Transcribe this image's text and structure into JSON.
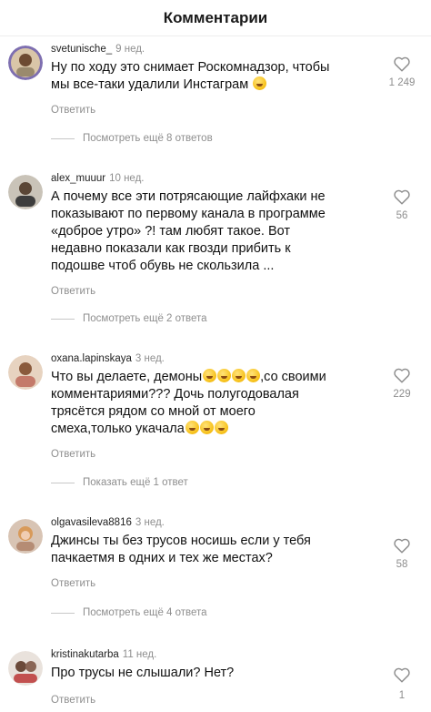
{
  "header": {
    "title": "Комментарии"
  },
  "comments": [
    {
      "username": "svetunische_",
      "time": "9 нед.",
      "text_lines": [
        "Ну по ходу это снимает Роскомнадзор, чтобы",
        "мы все-таки удалили Инстаграм"
      ],
      "reply_label": "Ответить",
      "likes": "1 249",
      "view_replies": "Посмотреть ещё 8 ответов"
    },
    {
      "username": "alex_muuur",
      "time": "10 нед.",
      "text_lines": [
        "А почему все эти потрясающие лайфхаки не",
        "показывают по первому канала в программе",
        "«доброе утро» ?! там любят такое. Вот",
        "недавно показали как гвозди прибить к",
        "подошве чтоб обувь не скользила ..."
      ],
      "reply_label": "Ответить",
      "likes": "56",
      "view_replies": "Посмотреть ещё 2 ответа"
    },
    {
      "username": "oxana.lapinskaya",
      "time": "3 нед.",
      "text_lines": [
        "Что вы делаете, демоны",
        ",со своими",
        "комментариями??? Дочь полугодовалая",
        "трясётся рядом со мной от моего",
        "смеха,только укачала"
      ],
      "reply_label": "Ответить",
      "likes": "229",
      "view_replies": "Показать ещё 1 ответ"
    },
    {
      "username": "olgavasileva8816",
      "time": "3 нед.",
      "text_lines": [
        "Джинсы ты без трусов носишь если у тебя",
        "пачкаетмя в одних и тех же местах?"
      ],
      "reply_label": "Ответить",
      "likes": "58",
      "view_replies": "Посмотреть ещё 4 ответа"
    },
    {
      "username": "kristinakutarba",
      "time": "11 нед.",
      "text_lines": [
        "Про трусы не слышали? Нет?"
      ],
      "reply_label": "Ответить",
      "likes": "1"
    }
  ],
  "icons": {
    "like": "heart-outline-icon",
    "emoji": "laughing-emoji-icon"
  },
  "colors": {
    "secondary_text": "#8e8e8e",
    "primary_text": "#111111"
  }
}
